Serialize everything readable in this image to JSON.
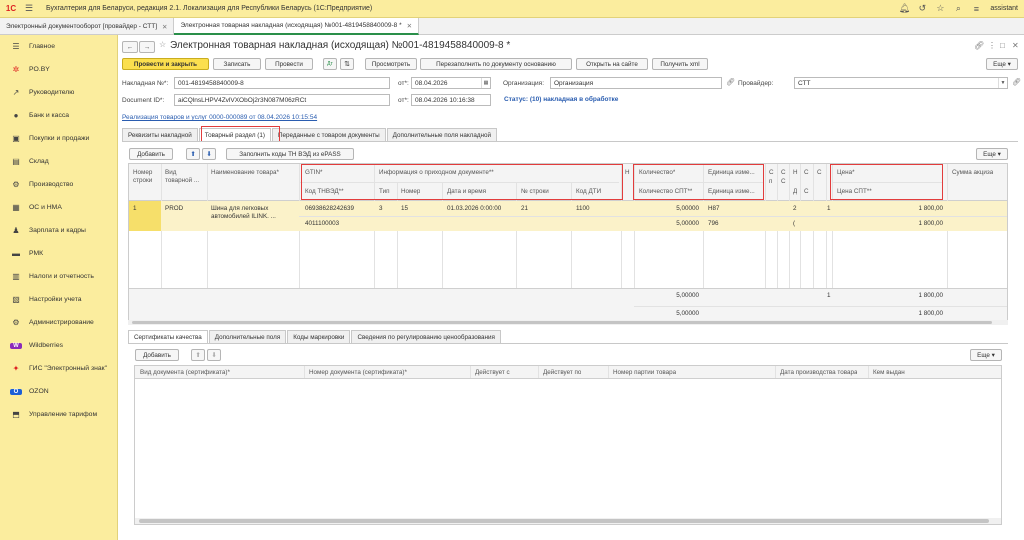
{
  "app": {
    "logo": "1С",
    "title": "Бухгалтерия для Беларуси, редакция 2.1. Локализация для Республики Беларусь  (1С:Предприятие)",
    "user": "assistant"
  },
  "open_tabs": [
    {
      "label": "Электронный документооборот [провайдер - СТТ]"
    },
    {
      "label": "Электронная товарная накладная (исходящая) №001-4819458840009-8 *"
    }
  ],
  "sidebar": {
    "items": [
      {
        "label": "Главное",
        "icon": "☰"
      },
      {
        "label": "PO.BY",
        "icon": "✲"
      },
      {
        "label": "Руководителю",
        "icon": "↗"
      },
      {
        "label": "Банк и касса",
        "icon": "●"
      },
      {
        "label": "Покупки и продажи",
        "icon": "▣"
      },
      {
        "label": "Склад",
        "icon": "▤"
      },
      {
        "label": "Производство",
        "icon": "⚙"
      },
      {
        "label": "ОС и НМА",
        "icon": "▦"
      },
      {
        "label": "Зарплата и кадры",
        "icon": "♟"
      },
      {
        "label": "РМК",
        "icon": "▬"
      },
      {
        "label": "Налоги и отчетность",
        "icon": "▥"
      },
      {
        "label": "Настройки учета",
        "icon": "▧"
      },
      {
        "label": "Администрирование",
        "icon": "⚙"
      },
      {
        "label": "Wildberries",
        "icon": "W"
      },
      {
        "label": "ГИС \"Электронный знак\"",
        "icon": "✦"
      },
      {
        "label": "OZON",
        "icon": "O"
      },
      {
        "label": "Управление тарифом",
        "icon": "⬒"
      }
    ]
  },
  "doc": {
    "title": "Электронная товарная накладная (исходящая) №001-4819458840009-8 *",
    "toolbar": {
      "post_close": "Провести и закрыть",
      "save": "Записать",
      "post": "Провести",
      "preview": "Просмотреть",
      "refill": "Перезаполнить по документу основанию",
      "open_site": "Открыть на сайте",
      "get_xml": "Получить xml",
      "more": "Еще"
    },
    "fields": {
      "invoice_label": "Накладная №*:",
      "invoice_value": "001-4819458840009-8",
      "date_label": "от*:",
      "date_value": "08.04.2026",
      "org_label": "Организация:",
      "org_value": "Организация",
      "provider_label": "Провайдер:",
      "provider_value": "СТТ",
      "docid_label": "Document ID*:",
      "docid_value": "aiCQlnsLHPV4ZvlVXObOj2r3N087M06zRCt",
      "datetime_label": "от*:",
      "datetime_value": "08.04.2026 10:16:38",
      "status": "Статус: (10) накладная в обработке",
      "basis_link": "Реализация товаров и услуг 0000-000089 от 08.04.2026 10:15:54"
    },
    "tabs": [
      {
        "label": "Реквизиты накладной"
      },
      {
        "label": "Товарный раздел (1)"
      },
      {
        "label": "Переданные с товаром документы"
      },
      {
        "label": "Дополнительные поля накладной"
      }
    ],
    "items_toolbar": {
      "add": "Добавить",
      "fill_codes": "Заполнить коды ТН ВЭД из ePASS",
      "more": "Еще"
    },
    "columns": {
      "row_no": "Номер строки",
      "goods_type": "Вид товарной ...",
      "name": "Наименование товара*",
      "gtin": "GTIN*",
      "tnved": "Код ТНВЭД**",
      "incoming": "Информация о приходном документе**",
      "type": "Тип",
      "number": "Номер",
      "datetime": "Дата и время",
      "line_no": "№ строки",
      "dti": "Код ДТИ",
      "n": "Н",
      "qty": "Количество*",
      "qty_spt": "Количество СПТ**",
      "unit": "Единица изме...",
      "unit_spt": "Единица изме...",
      "c1": "С",
      "c1b": "п",
      "c2": "С",
      "c2b": "С",
      "c3": "Н",
      "c3b": "Д",
      "c4": "С",
      "c4b": "С",
      "c5": "С",
      "price": "Цена*",
      "price_spt": "Цена СПТ**",
      "excise": "Сумма акциза"
    },
    "rows": [
      {
        "row_no": "1",
        "goods_type": "PROD",
        "name": "Шина для легковых автомобилей ILINK. ...",
        "gtin": "06938628242639",
        "tnved": "4011100003",
        "type": "3",
        "number": "15",
        "datetime": "01.03.2026 0:00:00",
        "line_no": "21",
        "dti": "1100",
        "qty": "5,00000",
        "qty_spt": "5,00000",
        "unit": "H87",
        "unit_spt": "796",
        "c3v": "2",
        "c3v2": "(",
        "c5v": "1",
        "price": "1 800,00",
        "price_spt": "1 800,00"
      }
    ],
    "totals": {
      "qty": "5,00000",
      "qty_spt": "5,00000",
      "c5": "1",
      "price": "1 800,00",
      "price_spt": "1 800,00"
    },
    "bottom_tabs": [
      {
        "label": "Сертификаты качества"
      },
      {
        "label": "Дополнительные поля"
      },
      {
        "label": "Коды маркировки"
      },
      {
        "label": "Сведения по регулированию ценообразования"
      }
    ],
    "bottom_toolbar": {
      "add": "Добавить",
      "more": "Еще"
    },
    "bottom_columns": {
      "doc_type": "Вид документа (сертификата)*",
      "doc_no": "Номер документа (сертификата)*",
      "valid_from": "Действует с",
      "valid_to": "Действует по",
      "batch": "Номер партии товара",
      "prod_date": "Дата производства товара",
      "issued_by": "Кем выдан"
    }
  }
}
